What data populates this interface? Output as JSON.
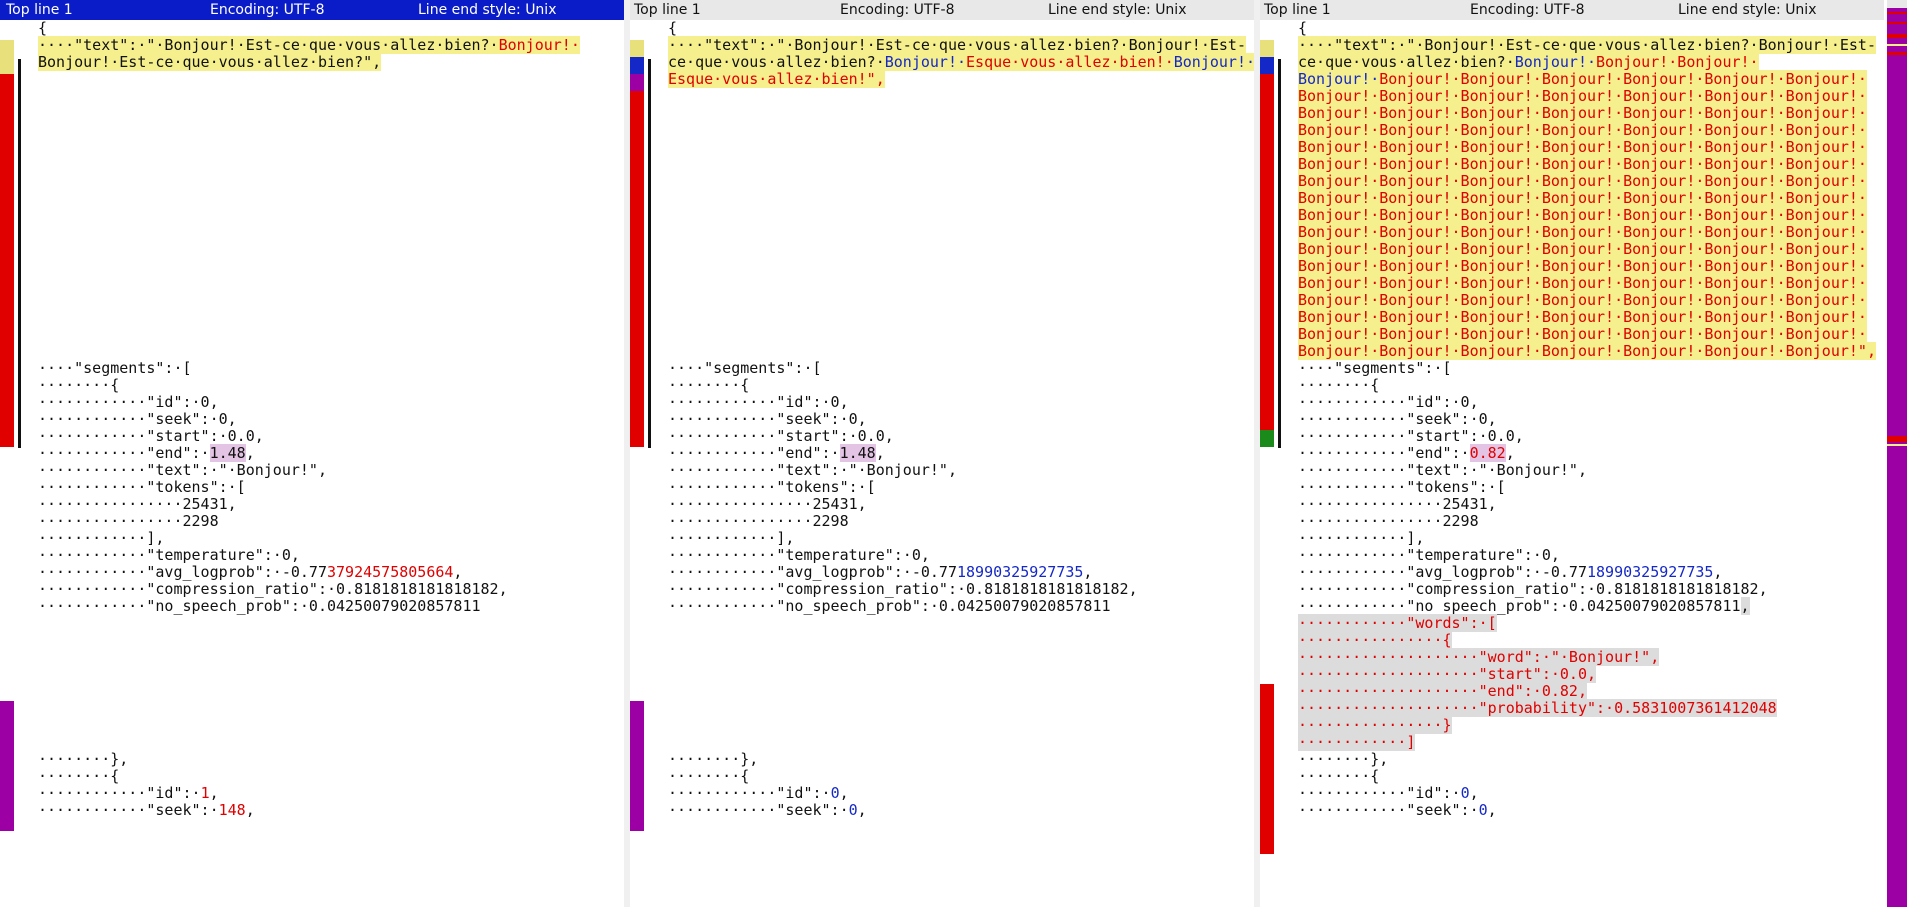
{
  "panes": [
    {
      "header": {
        "top_line": "Top line 1",
        "encoding": "Encoding: UTF-8",
        "line_end": "Line end style: Unix"
      },
      "active": true,
      "lines": [
        [
          {
            "t": "{"
          }
        ],
        [
          {
            "t": "····\"text\":·\"·Bonjour!·Est-ce·que·vous·allez·bien?·",
            "c": "hl"
          },
          {
            "t": "Bonjour!·",
            "c": "hl red"
          }
        ],
        [
          {
            "t": "Bonjour!·Est-ce·que·vous·allez·bien?\",",
            "c": "hl"
          }
        ],
        [],
        [],
        [],
        [],
        [],
        [],
        [],
        [],
        [],
        [],
        [],
        [],
        [],
        [],
        [],
        [],
        [],
        [
          {
            "t": "····\"segments\":·["
          }
        ],
        [
          {
            "t": "········{"
          }
        ],
        [
          {
            "t": "············\"id\":·0,"
          }
        ],
        [
          {
            "t": "············\"seek\":·0,"
          }
        ],
        [
          {
            "t": "············\"start\":·0.0,"
          }
        ],
        [
          {
            "t": "············\"end\":·"
          },
          {
            "t": "1.48",
            "c": "pur-bg"
          },
          {
            "t": ","
          }
        ],
        [
          {
            "t": "············\"text\":·\"·Bonjour!\","
          }
        ],
        [
          {
            "t": "············\"tokens\":·["
          }
        ],
        [
          {
            "t": "················25431,"
          }
        ],
        [
          {
            "t": "················2298"
          }
        ],
        [
          {
            "t": "············],"
          }
        ],
        [
          {
            "t": "············\"temperature\":·0,"
          }
        ],
        [
          {
            "t": "············\"avg_logprob\":·-0.77"
          },
          {
            "t": "37924575805664",
            "c": "red"
          },
          {
            "t": ","
          }
        ],
        [
          {
            "t": "············\"compression_ratio\":·0.8181818181818182,"
          }
        ],
        [
          {
            "t": "············\"no_speech_prob\":·0.04250079020857811"
          }
        ],
        [],
        [],
        [],
        [],
        [],
        [],
        [],
        [],
        [
          {
            "t": "········},"
          }
        ],
        [
          {
            "t": "········{"
          }
        ],
        [
          {
            "t": "············\"id\":·"
          },
          {
            "t": "1",
            "c": "red"
          },
          {
            "t": ","
          }
        ],
        [
          {
            "t": "············\"seek\":·"
          },
          {
            "t": "148",
            "c": "red"
          },
          {
            "t": ","
          }
        ]
      ]
    },
    {
      "header": {
        "top_line": "Top line 1",
        "encoding": "Encoding: UTF-8",
        "line_end": "Line end style: Unix"
      },
      "active": false,
      "lines": [
        [
          {
            "t": "{"
          }
        ],
        [
          {
            "t": "····\"text\":·\"·Bonjour!·Est-ce·que·vous·allez·bien?·Bonjour!·Est-",
            "c": "hl"
          }
        ],
        [
          {
            "t": "ce·que·vous·allez·bien?·",
            "c": "hl"
          },
          {
            "t": "Bonjour!·",
            "c": "hl blue"
          },
          {
            "t": "Esque·vous·allez·bien!·",
            "c": "hl red"
          },
          {
            "t": "Bonjour!·",
            "c": "hl blue"
          }
        ],
        [
          {
            "t": "Esque·vous·allez·bien!\",",
            "c": "hl red"
          }
        ],
        [],
        [],
        [],
        [],
        [],
        [],
        [],
        [],
        [],
        [],
        [],
        [],
        [],
        [],
        [],
        [],
        [
          {
            "t": "····\"segments\":·["
          }
        ],
        [
          {
            "t": "········{"
          }
        ],
        [
          {
            "t": "············\"id\":·0,"
          }
        ],
        [
          {
            "t": "············\"seek\":·0,"
          }
        ],
        [
          {
            "t": "············\"start\":·0.0,"
          }
        ],
        [
          {
            "t": "············\"end\":·"
          },
          {
            "t": "1.48",
            "c": "pur-bg"
          },
          {
            "t": ","
          }
        ],
        [
          {
            "t": "············\"text\":·\"·Bonjour!\","
          }
        ],
        [
          {
            "t": "············\"tokens\":·["
          }
        ],
        [
          {
            "t": "················25431,"
          }
        ],
        [
          {
            "t": "················2298"
          }
        ],
        [
          {
            "t": "············],"
          }
        ],
        [
          {
            "t": "············\"temperature\":·0,"
          }
        ],
        [
          {
            "t": "············\"avg_logprob\":·-0.77"
          },
          {
            "t": "18990325927735",
            "c": "blue"
          },
          {
            "t": ","
          }
        ],
        [
          {
            "t": "············\"compression_ratio\":·0.8181818181818182,"
          }
        ],
        [
          {
            "t": "············\"no_speech_prob\":·0.04250079020857811"
          }
        ],
        [],
        [],
        [],
        [],
        [],
        [],
        [],
        [],
        [
          {
            "t": "········},"
          }
        ],
        [
          {
            "t": "········{"
          }
        ],
        [
          {
            "t": "············\"id\":·"
          },
          {
            "t": "0",
            "c": "blue"
          },
          {
            "t": ","
          }
        ],
        [
          {
            "t": "············\"seek\":·"
          },
          {
            "t": "0",
            "c": "blue"
          },
          {
            "t": ","
          }
        ]
      ]
    },
    {
      "header": {
        "top_line": "Top line 1",
        "encoding": "Encoding: UTF-8",
        "line_end": "Line end style: Unix"
      },
      "active": false,
      "lines": [
        [
          {
            "t": "{"
          }
        ],
        [
          {
            "t": "····\"text\":·\"·Bonjour!·Est-ce·que·vous·allez·bien?·Bonjour!·Est-",
            "c": "hl"
          }
        ],
        [
          {
            "t": "ce·que·vous·allez·bien?·",
            "c": "hl"
          },
          {
            "t": "Bonjour!·",
            "c": "hl blue"
          },
          {
            "t": "Bonjour!·Bonjour!·",
            "c": "hl red"
          }
        ],
        [
          {
            "t": "Bonjour!·",
            "c": "hl blue"
          },
          {
            "t": "Bonjour!·Bonjour!·Bonjour!·Bonjour!·Bonjour!·Bonjour!·",
            "c": "hl red"
          }
        ],
        [
          {
            "t": "Bonjour!·Bonjour!·Bonjour!·Bonjour!·Bonjour!·Bonjour!·Bonjour!·",
            "c": "hl red"
          }
        ],
        [
          {
            "t": "Bonjour!·Bonjour!·Bonjour!·Bonjour!·Bonjour!·Bonjour!·Bonjour!·",
            "c": "hl red"
          }
        ],
        [
          {
            "t": "Bonjour!·Bonjour!·Bonjour!·Bonjour!·Bonjour!·Bonjour!·Bonjour!·",
            "c": "hl red"
          }
        ],
        [
          {
            "t": "Bonjour!·Bonjour!·Bonjour!·Bonjour!·Bonjour!·Bonjour!·Bonjour!·",
            "c": "hl red"
          }
        ],
        [
          {
            "t": "Bonjour!·Bonjour!·Bonjour!·Bonjour!·Bonjour!·Bonjour!·Bonjour!·",
            "c": "hl red"
          }
        ],
        [
          {
            "t": "Bonjour!·Bonjour!·Bonjour!·Bonjour!·Bonjour!·Bonjour!·Bonjour!·",
            "c": "hl red"
          }
        ],
        [
          {
            "t": "Bonjour!·Bonjour!·Bonjour!·Bonjour!·Bonjour!·Bonjour!·Bonjour!·",
            "c": "hl red"
          }
        ],
        [
          {
            "t": "Bonjour!·Bonjour!·Bonjour!·Bonjour!·Bonjour!·Bonjour!·Bonjour!·",
            "c": "hl red"
          }
        ],
        [
          {
            "t": "Bonjour!·Bonjour!·Bonjour!·Bonjour!·Bonjour!·Bonjour!·Bonjour!·",
            "c": "hl red"
          }
        ],
        [
          {
            "t": "Bonjour!·Bonjour!·Bonjour!·Bonjour!·Bonjour!·Bonjour!·Bonjour!·",
            "c": "hl red"
          }
        ],
        [
          {
            "t": "Bonjour!·Bonjour!·Bonjour!·Bonjour!·Bonjour!·Bonjour!·Bonjour!·",
            "c": "hl red"
          }
        ],
        [
          {
            "t": "Bonjour!·Bonjour!·Bonjour!·Bonjour!·Bonjour!·Bonjour!·Bonjour!·",
            "c": "hl red"
          }
        ],
        [
          {
            "t": "Bonjour!·Bonjour!·Bonjour!·Bonjour!·Bonjour!·Bonjour!·Bonjour!·",
            "c": "hl red"
          }
        ],
        [
          {
            "t": "Bonjour!·Bonjour!·Bonjour!·Bonjour!·Bonjour!·Bonjour!·Bonjour!·",
            "c": "hl red"
          }
        ],
        [
          {
            "t": "Bonjour!·Bonjour!·Bonjour!·Bonjour!·Bonjour!·Bonjour!·Bonjour!·",
            "c": "hl red"
          }
        ],
        [
          {
            "t": "Bonjour!·Bonjour!·Bonjour!·Bonjour!·Bonjour!·Bonjour!·Bonjour!\",",
            "c": "hl red"
          }
        ],
        [
          {
            "t": "····\"segments\":·["
          }
        ],
        [
          {
            "t": "········{"
          }
        ],
        [
          {
            "t": "············\"id\":·0,"
          }
        ],
        [
          {
            "t": "············\"seek\":·0,"
          }
        ],
        [
          {
            "t": "············\"start\":·0.0,"
          }
        ],
        [
          {
            "t": "············\"end\":·"
          },
          {
            "t": "0.82",
            "c": "pur-bg red"
          },
          {
            "t": ","
          }
        ],
        [
          {
            "t": "············\"text\":·\"·Bonjour!\","
          }
        ],
        [
          {
            "t": "············\"tokens\":·["
          }
        ],
        [
          {
            "t": "················25431,"
          }
        ],
        [
          {
            "t": "················2298"
          }
        ],
        [
          {
            "t": "············],"
          }
        ],
        [
          {
            "t": "············\"temperature\":·0,"
          }
        ],
        [
          {
            "t": "············\"avg_logprob\":·-0.77"
          },
          {
            "t": "18990325927735",
            "c": "blue"
          },
          {
            "t": ","
          }
        ],
        [
          {
            "t": "············\"compression_ratio\":·0.8181818181818182,"
          }
        ],
        [
          {
            "t": "············\"no_speech_prob\":·0.04250079020857811"
          },
          {
            "t": ",",
            "c": "gray-bg"
          }
        ],
        [
          {
            "t": "············\"words\":·[",
            "c": "gray-bg red"
          }
        ],
        [
          {
            "t": "················{",
            "c": "gray-bg red"
          }
        ],
        [
          {
            "t": "····················\"word\":·\"·Bonjour!\",",
            "c": "gray-bg red"
          }
        ],
        [
          {
            "t": "····················\"start\":·0.0,",
            "c": "gray-bg red"
          }
        ],
        [
          {
            "t": "····················\"end\":·0.82,",
            "c": "gray-bg red"
          }
        ],
        [
          {
            "t": "····················\"probability\":·0.5831007361412048",
            "c": "gray-bg red"
          }
        ],
        [
          {
            "t": "················}",
            "c": "gray-bg red"
          }
        ],
        [
          {
            "t": "············]",
            "c": "gray-bg red"
          }
        ],
        [
          {
            "t": "········},"
          }
        ],
        [
          {
            "t": "········{"
          }
        ],
        [
          {
            "t": "············\"id\":·"
          },
          {
            "t": "0",
            "c": "blue"
          },
          {
            "t": ","
          }
        ],
        [
          {
            "t": "············\"seek\":·"
          },
          {
            "t": "0",
            "c": "blue"
          },
          {
            "t": ","
          }
        ]
      ]
    }
  ],
  "colors": {
    "change": "#e00000",
    "add": "#1428c8",
    "move": "#9c00a4",
    "highlight": "#f5f08d"
  }
}
